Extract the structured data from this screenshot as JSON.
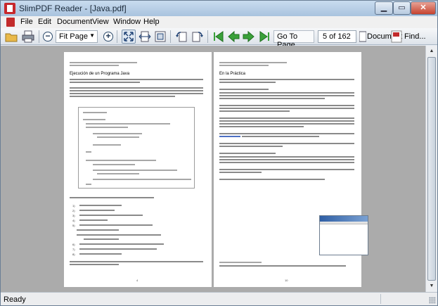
{
  "window": {
    "title": "SlimPDF Reader - [Java.pdf]"
  },
  "menu": [
    "File",
    "Edit",
    "Document",
    "View",
    "Window",
    "Help"
  ],
  "toolbar": {
    "zoom_value": "Fit Page",
    "goto_label": "Go To Page",
    "page_value": "5 of 162",
    "document_label": "Document",
    "find_label": "Find...",
    "icons": [
      "open-folder-icon",
      "print-icon",
      "zoom-out-icon",
      "zoom-in-icon",
      "fit-page-icon",
      "fit-width-icon",
      "actual-size-icon",
      "rotate-left-icon",
      "rotate-right-icon",
      "first-page-icon",
      "previous-page-icon",
      "next-page-icon",
      "last-page-icon",
      "document-icon",
      "find-icon"
    ]
  },
  "document": {
    "left_page": {
      "section_heading": "Ejecución de un Programa Java",
      "item_numbers": [
        "1)",
        "2)",
        "3)",
        "4)",
        "5)",
        "6)",
        "7)",
        "8)",
        "9)"
      ],
      "page_number": "4"
    },
    "right_page": {
      "section_heading": "En la Práctica",
      "page_number": "10"
    }
  },
  "status": {
    "text": "Ready"
  },
  "colors": {
    "title_bar": "#b9cfe6",
    "page_background": "#ababab",
    "accent_green": "#3aa13a"
  }
}
